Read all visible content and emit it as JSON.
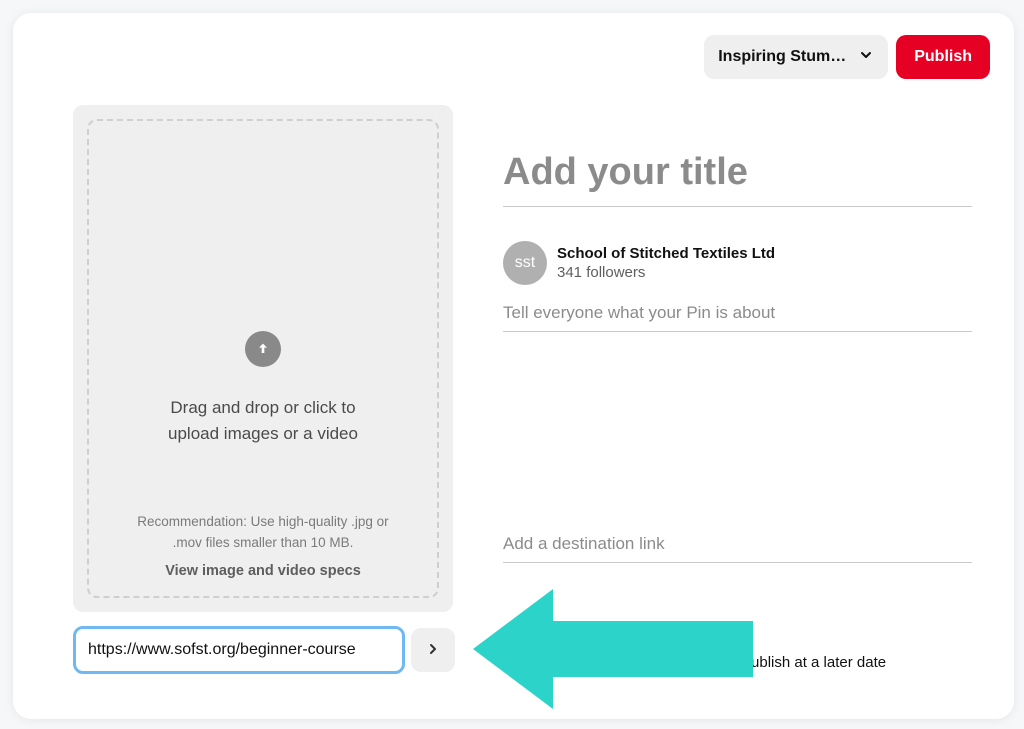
{
  "topbar": {
    "board_selected": "Inspiring Stum…",
    "publish": "Publish"
  },
  "upload": {
    "main_line1": "Drag and drop or click to",
    "main_line2": "upload images or a video",
    "rec_line1": "Recommendation: Use high-quality .jpg or",
    "rec_line2": ".mov files smaller than 10 MB.",
    "specs_link": "View image and video specs"
  },
  "url_input_value": "https://www.sofst.org/beginner-course",
  "form": {
    "title_placeholder": "Add your title",
    "author_name": "School of Stitched Textiles Ltd",
    "author_followers": "341 followers",
    "avatar_initials": "sst",
    "desc_placeholder": "Tell everyone what your Pin is about",
    "link_placeholder": "Add a destination link"
  },
  "publish_options": {
    "later_label": "Publish at a later date"
  },
  "accent_color": "#2bd3c9"
}
